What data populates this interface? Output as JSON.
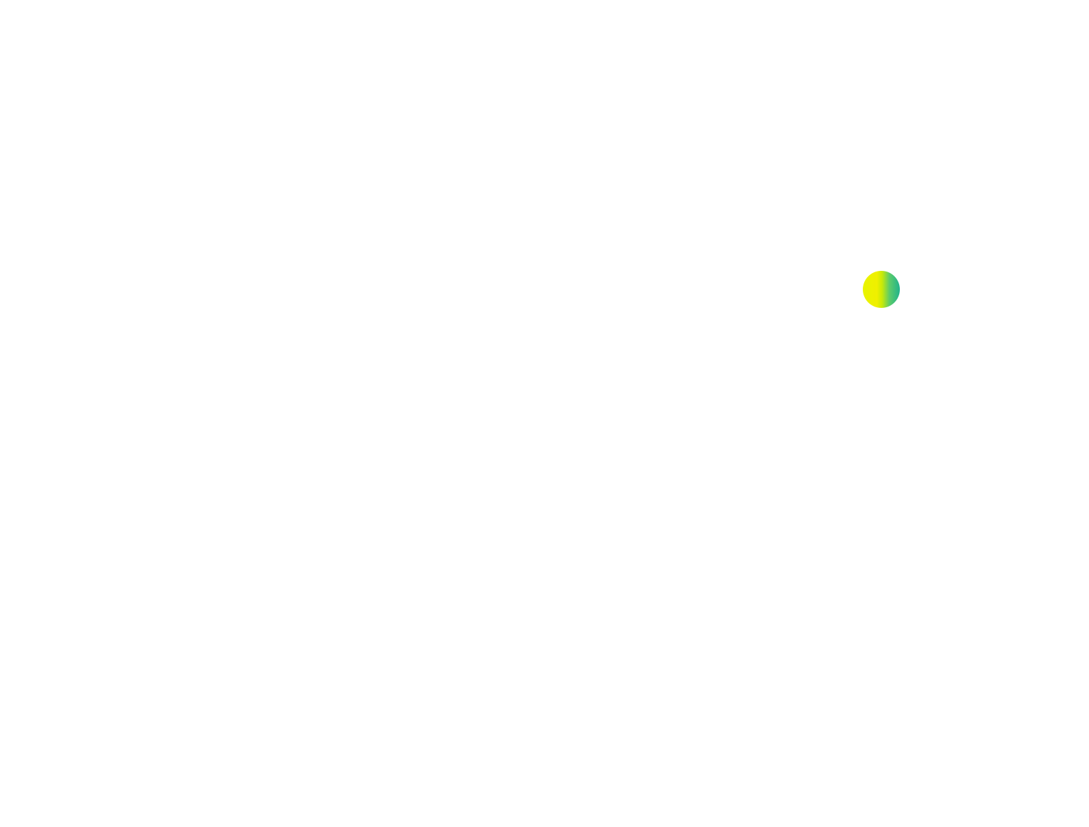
{
  "background_color": "#ffffff",
  "dot": {
    "icon": "gradient-circle",
    "gradient_start_color": "#e8f400",
    "gradient_end_color": "#21b28c"
  }
}
